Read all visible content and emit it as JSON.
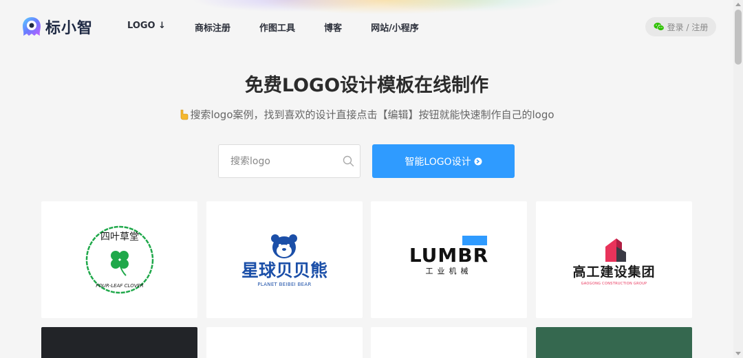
{
  "brand": {
    "name": "标小智",
    "accent": "#2f9bff"
  },
  "nav": {
    "items": [
      {
        "label": "LOGO ↓"
      },
      {
        "label": "商标注册"
      },
      {
        "label": "作图工具"
      },
      {
        "label": "博客"
      },
      {
        "label": "网站/小程序"
      }
    ]
  },
  "auth": {
    "label": "登录 / 注册",
    "icon": "wechat-icon"
  },
  "hero": {
    "title": "免费LOGO设计模板在线制作",
    "subtitle": "搜索logo案例，找到喜欢的设计直接点击【编辑】按钮就能快速制作自己的logo"
  },
  "search": {
    "placeholder": "搜索logo",
    "value": ""
  },
  "cta": {
    "label": "智能LOGO设计"
  },
  "cards": [
    {
      "top_text": "四叶草堂",
      "bottom_text": "FOUR-LEAF CLOVER",
      "color": "#1fa84a"
    },
    {
      "main": "星球贝贝熊",
      "sub": "PLANET BEIBEI BEAR",
      "color": "#1b4fa8"
    },
    {
      "main": "LUMBR",
      "sub": "工业机械",
      "accent": "#2f9bff"
    },
    {
      "main": "高工建设集团",
      "sub": "GAOGONG CONSTRUCTION GROUP",
      "accent": "#e8335a"
    }
  ],
  "row2_colors": [
    "#222428",
    "#ffffff",
    "#ffffff",
    "#35684f"
  ]
}
